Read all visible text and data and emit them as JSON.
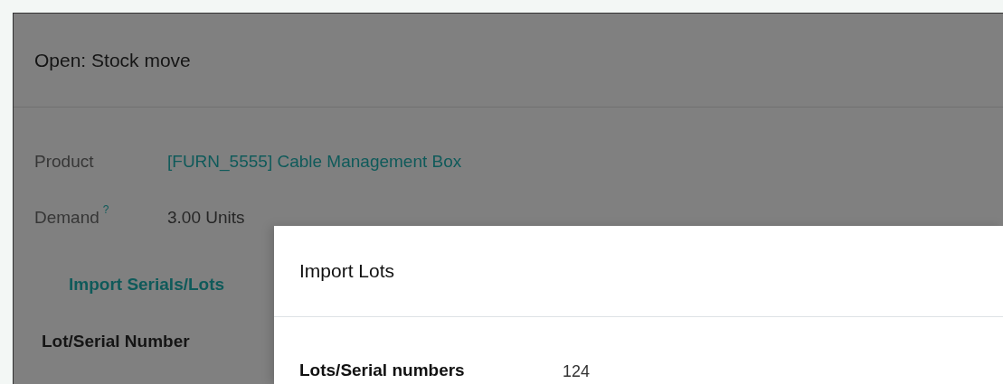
{
  "background_dialog": {
    "title": "Open: Stock move",
    "fields": [
      {
        "label": "Product",
        "value": "[FURN_5555] Cable Management Box",
        "kind": "link"
      },
      {
        "label": "Demand",
        "help": "?",
        "value": "3.00 Units",
        "kind": "text"
      }
    ],
    "action_link": "Import Serials/Lots",
    "table": {
      "columns": [
        "Lot/Serial Number"
      ]
    }
  },
  "modal": {
    "title": "Import Lots",
    "fields": [
      {
        "label": "Lots/Serial numbers",
        "value": "124"
      }
    ]
  }
}
